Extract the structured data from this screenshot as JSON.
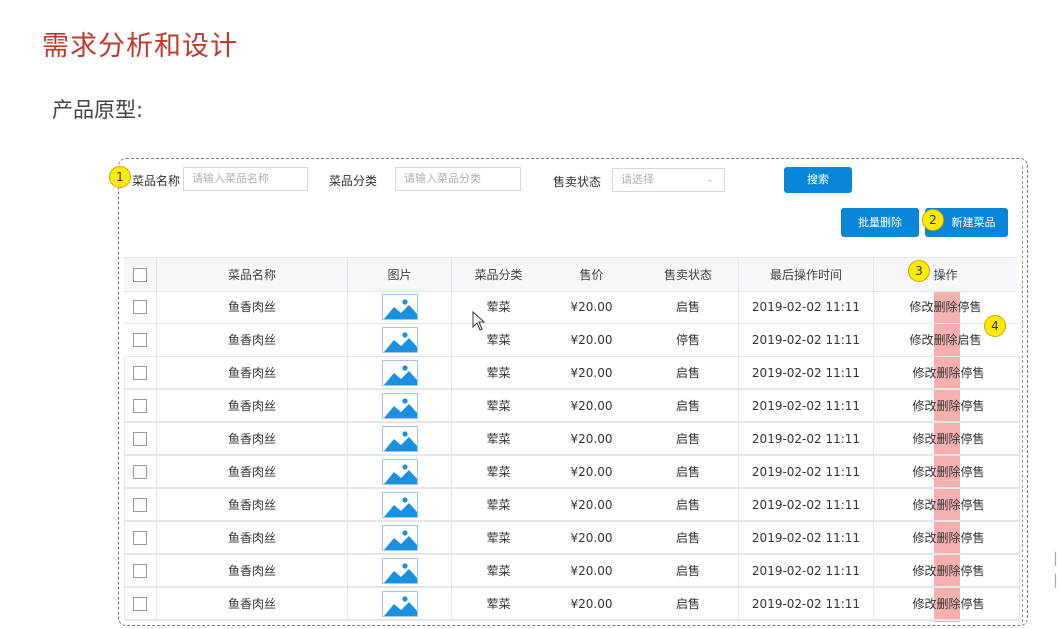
{
  "heading": "需求分析和设计",
  "subheading": "产品原型:",
  "markers": [
    "1",
    "2",
    "3",
    "4"
  ],
  "search": {
    "name_label": "菜品名称",
    "name_placeholder": "请输入菜品名称",
    "category_label": "菜品分类",
    "category_placeholder": "请输入菜品分类",
    "status_label": "售卖状态",
    "status_placeholder": "请选择",
    "search_button": "搜索"
  },
  "toolbar": {
    "batch_delete": "批量删除",
    "new_dish": "新建菜品"
  },
  "table": {
    "columns": [
      "菜品名称",
      "图片",
      "菜品分类",
      "售价",
      "售卖状态",
      "最后操作时间",
      "操作"
    ],
    "rows": [
      {
        "name": "鱼香肉丝",
        "category": "荤菜",
        "price": "¥20.00",
        "status": "启售",
        "time": "2019-02-02 11:11",
        "edit": "修改",
        "delete": "删除",
        "toggle": "停售"
      },
      {
        "name": "鱼香肉丝",
        "category": "荤菜",
        "price": "¥20.00",
        "status": "停售",
        "time": "2019-02-02 11:11",
        "edit": "修改",
        "delete": "删除",
        "toggle": "启售"
      },
      {
        "name": "鱼香肉丝",
        "category": "荤菜",
        "price": "¥20.00",
        "status": "启售",
        "time": "2019-02-02 11:11",
        "edit": "修改",
        "delete": "删除",
        "toggle": "停售"
      },
      {
        "name": "鱼香肉丝",
        "category": "荤菜",
        "price": "¥20.00",
        "status": "启售",
        "time": "2019-02-02 11:11",
        "edit": "修改",
        "delete": "删除",
        "toggle": "停售"
      },
      {
        "name": "鱼香肉丝",
        "category": "荤菜",
        "price": "¥20.00",
        "status": "启售",
        "time": "2019-02-02 11:11",
        "edit": "修改",
        "delete": "删除",
        "toggle": "停售"
      },
      {
        "name": "鱼香肉丝",
        "category": "荤菜",
        "price": "¥20.00",
        "status": "启售",
        "time": "2019-02-02 11:11",
        "edit": "修改",
        "delete": "删除",
        "toggle": "停售"
      },
      {
        "name": "鱼香肉丝",
        "category": "荤菜",
        "price": "¥20.00",
        "status": "启售",
        "time": "2019-02-02 11:11",
        "edit": "修改",
        "delete": "删除",
        "toggle": "停售"
      },
      {
        "name": "鱼香肉丝",
        "category": "荤菜",
        "price": "¥20.00",
        "status": "启售",
        "time": "2019-02-02 11:11",
        "edit": "修改",
        "delete": "删除",
        "toggle": "停售"
      },
      {
        "name": "鱼香肉丝",
        "category": "荤菜",
        "price": "¥20.00",
        "status": "启售",
        "time": "2019-02-02 11:11",
        "edit": "修改",
        "delete": "删除",
        "toggle": "停售"
      },
      {
        "name": "鱼香肉丝",
        "category": "荤菜",
        "price": "¥20.00",
        "status": "启售",
        "time": "2019-02-02 11:11",
        "edit": "修改",
        "delete": "删除",
        "toggle": "停售"
      }
    ]
  },
  "colors": {
    "heading": "#c0392b",
    "button": "#0a86d8",
    "marker": "#ffeb00",
    "delete_highlight": "#f49696"
  },
  "icons": [
    "image-placeholder-icon",
    "chevron-down-icon",
    "mouse-cursor-icon",
    "checkbox-icon"
  ]
}
